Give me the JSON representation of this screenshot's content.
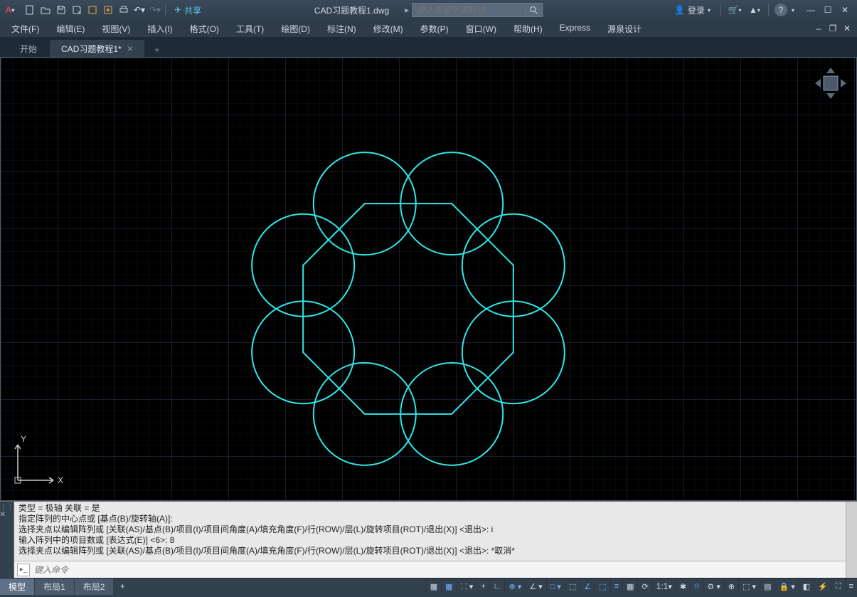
{
  "titlebar": {
    "logo_letter": "A",
    "share_label": "共享",
    "document_title": "CAD习题教程1.dwg",
    "search_placeholder": "键入关键字或短语",
    "login_label": "登录"
  },
  "menubar": {
    "items": [
      {
        "label": "文件(F)"
      },
      {
        "label": "编辑(E)"
      },
      {
        "label": "视图(V)"
      },
      {
        "label": "插入(I)"
      },
      {
        "label": "格式(O)"
      },
      {
        "label": "工具(T)"
      },
      {
        "label": "绘图(D)"
      },
      {
        "label": "标注(N)"
      },
      {
        "label": "修改(M)"
      },
      {
        "label": "参数(P)"
      },
      {
        "label": "窗口(W)"
      },
      {
        "label": "帮助(H)"
      },
      {
        "label": "Express"
      },
      {
        "label": "源泉设计"
      }
    ]
  },
  "tabs": {
    "items": [
      {
        "label": "开始",
        "active": false,
        "closable": false
      },
      {
        "label": "CAD习题教程1*",
        "active": true,
        "closable": true
      }
    ]
  },
  "canvas": {
    "ucs": {
      "x_label": "X",
      "y_label": "Y"
    },
    "drawing": {
      "type": "polar-array",
      "center": [
        573,
        353
      ],
      "octagon_radius": 160,
      "circle_radius": 72,
      "circle_count": 8,
      "color": "#2fe7e7"
    }
  },
  "command": {
    "history": [
      "类型 = 极轴  关联 = 是",
      "指定阵列的中心点或 [基点(B)/旋转轴(A)]:",
      "选择夹点以编辑阵列或 [关联(AS)/基点(B)/项目(I)/项目间角度(A)/填充角度(F)/行(ROW)/层(L)/旋转项目(ROT)/退出(X)] <退出>: i",
      "输入阵列中的项目数或 [表达式(E)] <6>: 8",
      "选择夹点以编辑阵列或 [关联(AS)/基点(B)/项目(I)/项目间角度(A)/填充角度(F)/行(ROW)/层(L)/旋转项目(ROT)/退出(X)] <退出>: *取消*"
    ],
    "prompt_placeholder": "键入命令"
  },
  "layouts": {
    "items": [
      {
        "label": "模型",
        "active": true
      },
      {
        "label": "布局1",
        "active": false
      },
      {
        "label": "布局2",
        "active": false
      }
    ]
  },
  "status": {
    "scale": "1:1"
  }
}
